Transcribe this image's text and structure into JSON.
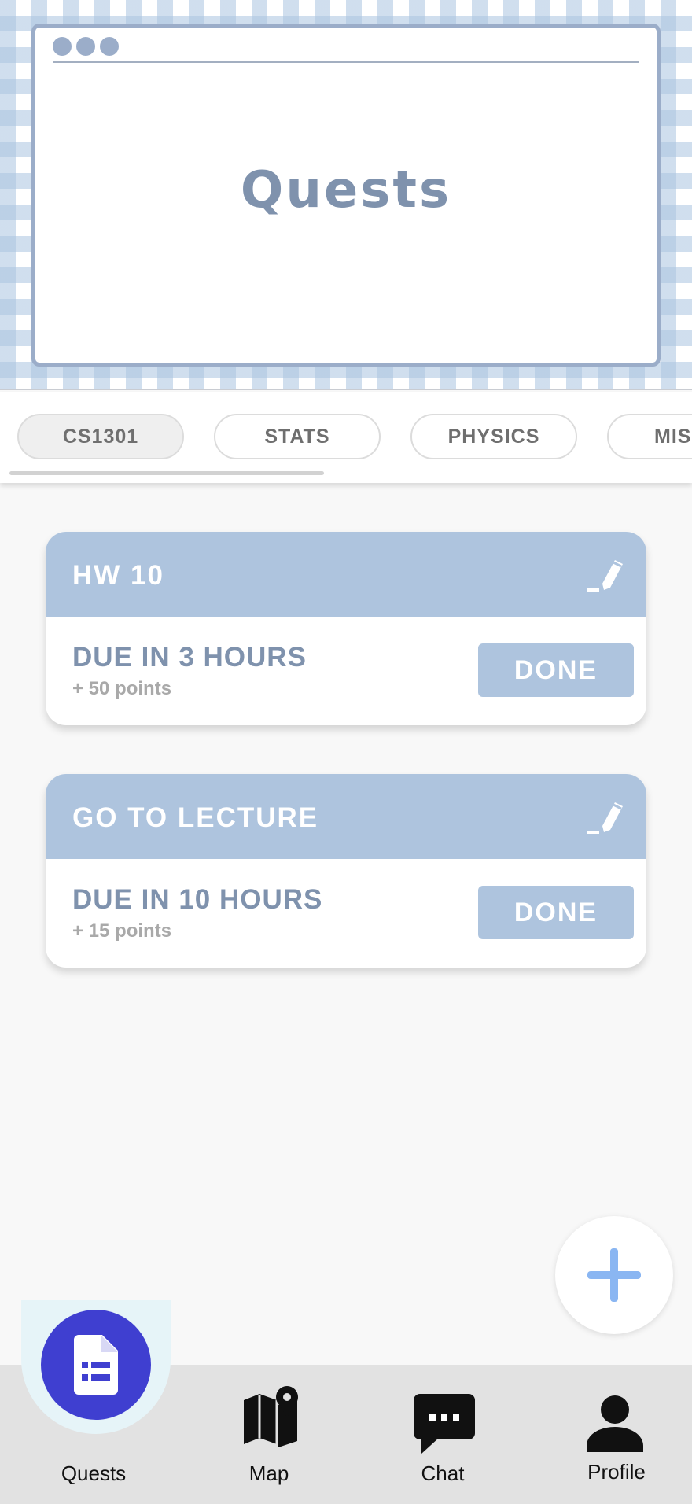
{
  "header": {
    "title": "Quests"
  },
  "tabs": [
    {
      "label": "CS1301",
      "active": true
    },
    {
      "label": "STATS",
      "active": false
    },
    {
      "label": "PHYSICS",
      "active": false
    },
    {
      "label": "MIS",
      "active": false
    }
  ],
  "quests": [
    {
      "title": "HW 10",
      "due": "DUE IN 3 HOURS",
      "points": "+ 50 points",
      "action": "DONE"
    },
    {
      "title": "GO TO LECTURE",
      "due": "DUE IN 10 HOURS",
      "points": "+ 15 points",
      "action": "DONE"
    }
  ],
  "nav": {
    "items": [
      {
        "label": "Quests",
        "icon": "document-list-icon",
        "active": true
      },
      {
        "label": "Map",
        "icon": "map-pin-icon",
        "active": false
      },
      {
        "label": "Chat",
        "icon": "chat-bubble-icon",
        "active": false
      },
      {
        "label": "Profile",
        "icon": "person-icon",
        "active": false
      }
    ]
  },
  "colors": {
    "accent": "#aec4de",
    "title_text": "#7f92ad",
    "active_nav": "#3f3fd0",
    "fab_plus": "#8ab6f2"
  }
}
